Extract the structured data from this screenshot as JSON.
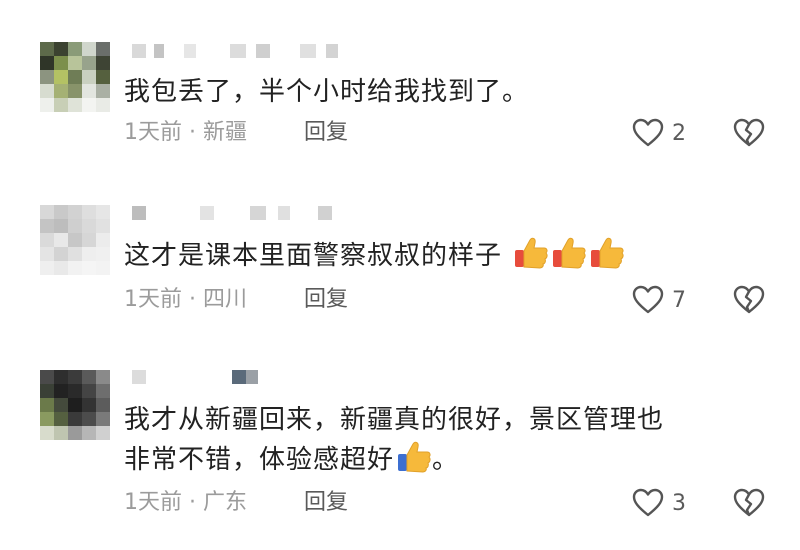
{
  "comments": [
    {
      "text_lines": [
        "我包丢了，半个小时给我找到了。"
      ],
      "thumbs": 0,
      "text_suffix": "",
      "meta": "1天前 · 新疆",
      "reply": "回复",
      "likes": "2"
    },
    {
      "text_lines": [
        "这才是课本里面警察叔叔的样子"
      ],
      "thumbs": 3,
      "text_suffix": "",
      "meta": "1天前 · 四川",
      "reply": "回复",
      "likes": "7"
    },
    {
      "text_lines": [
        "我才从新疆回来，新疆真的很好，景区管理也",
        "非常不错，体验感超好"
      ],
      "thumbs": 1,
      "text_suffix": "。",
      "meta": "1天前 · 广东",
      "reply": "回复",
      "likes": "3"
    }
  ],
  "colors": {
    "text": "#222222",
    "meta": "#9b9b9b",
    "icon": "#555555",
    "thumb": "#f6b93b",
    "cuff": "#e74c3c"
  },
  "icons": {
    "like": "heart-outline-icon",
    "dislike": "broken-heart-icon",
    "emoji": "thumbs-up-emoji"
  }
}
